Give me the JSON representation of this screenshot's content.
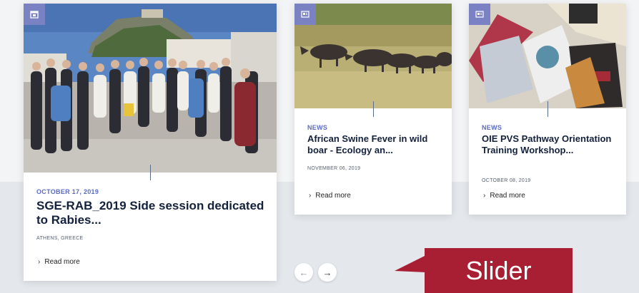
{
  "colors": {
    "accent": "#5b6cc2",
    "badge": "#7b82c4",
    "title": "#14213d",
    "callout": "#a81f34",
    "section_bg": "#e4e8ec"
  },
  "cards": [
    {
      "icon": "calendar-icon",
      "date": "OCTOBER 17, 2019",
      "title": "SGE-RAB_2019 Side session dedicated to Rabies...",
      "location": "ATHENS, GREECE",
      "read_more": "Read more"
    },
    {
      "icon": "newspaper-icon",
      "category": "NEWS",
      "title": "African Swine Fever in wild boar - Ecology an...",
      "date": "NOVEMBER 06, 2019",
      "read_more": "Read more"
    },
    {
      "icon": "newspaper-icon",
      "category": "NEWS",
      "title": "OIE PVS Pathway Orientation Training Workshop...",
      "date": "OCTOBER 08, 2019",
      "read_more": "Read more"
    }
  ],
  "slider": {
    "prev_icon": "arrow-left-icon",
    "next_icon": "arrow-right-icon",
    "prev_glyph": "←",
    "next_glyph": "→"
  },
  "annotation": {
    "label": "Slider"
  }
}
